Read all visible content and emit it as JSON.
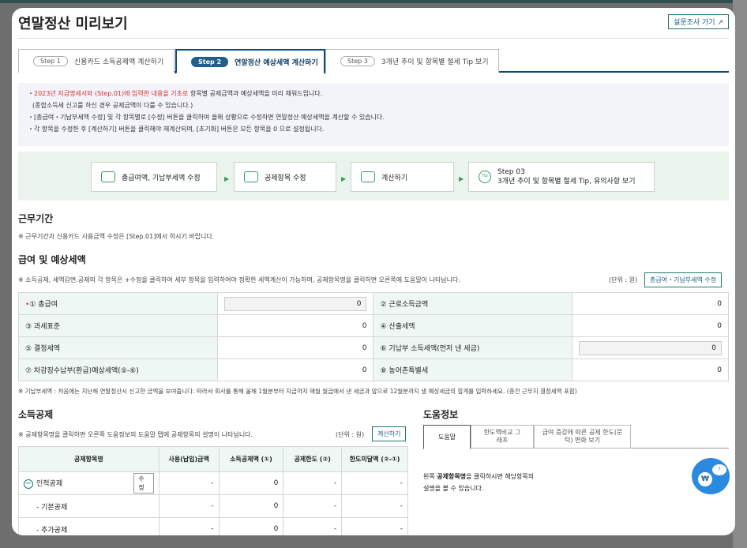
{
  "title": "연말정산 미리보기",
  "survey_button": "설문조사 가기 ↗",
  "tabs": [
    {
      "pill": "Step 1",
      "label": "신용카드 소득공제액 계산하기"
    },
    {
      "pill": "Step 2",
      "label": "연말정산 예상세액 계산하기"
    },
    {
      "pill": "Step 3",
      "label": "3개년 추이 및 항목별 절세 Tip 보기"
    }
  ],
  "notice": {
    "line1_red": "2023년 지급명세서와 (Step.01)에 입력한 내용을 기초로",
    "line1_rest": " 항목별 공제금액과 예상세액을 미리 채워드립니다.",
    "line2": "(종합소득세 신고를 하신 경우 공제금액이 다를 수 있습니다.)",
    "line3": "[총급여・기납부세액 수정] 및 각 항목별로 [수정] 버튼을 클릭하여 올해 상황으로 수정하면 연말정산 예상세액을 계산할 수 있습니다.",
    "line4": "각 항목을 수정한 후 [계산하기] 버튼을 클릭해야 재계산되며, [초기화] 버튼은 모든 항목을 0 으로 설정됩니다."
  },
  "steps": [
    {
      "label": "총급여액, 기납부세액 수정",
      "icon": "salary-edit-icon"
    },
    {
      "label": "공제항목 수정",
      "icon": "document-edit-icon"
    },
    {
      "label": "계산하기",
      "icon": "calculator-icon"
    },
    {
      "label_top": "Step 03",
      "label": "3개년 추이 및 항목별 절세 Tip, 유의사항 보기",
      "icon_text": "Tip"
    }
  ],
  "work_period": {
    "heading": "근무기간",
    "note": "※ 근무기간과 신용카드 사용금액 수정은 [Step.01]에서 하시기 바랍니다."
  },
  "salary": {
    "heading": "급여 및 예상세액",
    "note": "※ 소득공제, 세액감면.공제의 각 항목은 +수정을 클릭하여 세부 항목을 입력하여야 정확한 세액계산이 가능하며, 공제항목명을 클릭하면 오른쪽에 도움말이 나타납니다.",
    "unit": "(단위 : 원)",
    "edit_button": "총급여・기납부세액 수정",
    "rows": [
      [
        {
          "label": "① 총급여",
          "value": "0",
          "boxed": true,
          "required": true
        },
        {
          "label": "② 근로소득금액",
          "value": "0"
        }
      ],
      [
        {
          "label": "③ 과세표준",
          "value": "0"
        },
        {
          "label": "④ 산출세액",
          "value": "0"
        }
      ],
      [
        {
          "label": "⑤ 결정세액",
          "value": "0"
        },
        {
          "label": "⑥ 기납부 소득세액(먼저 낸 세금)",
          "value": "0",
          "boxed": true
        }
      ],
      [
        {
          "label": "⑦ 차감징수납부(환급)예상세액(⑤-⑥)",
          "value": "0"
        },
        {
          "label": "⑧ 농어촌특별세",
          "value": "0"
        }
      ]
    ],
    "footnote": "※ 기납부세액 : 처음에는 지난해 연말정산시 신고한 금액을 보여줍니다. 따라서 회사를 통해 올해 1월분부터 지급까지 매월 월급에서 낸 세금과 앞으로 12월분까지 낼 예상세금의 합계를 입력하세요. (종전 근무지 결정세액 포함)"
  },
  "deduction": {
    "heading": "소득공제",
    "note": "※ 공제항목명을 클릭하면 오른쪽 도움정보의 도움말 탭에 공제항목의 설명이 나타납니다.",
    "unit": "(단위 : 원)",
    "calc_button": "계산하기",
    "headers": [
      "공제항목명",
      "사용(납입)금액",
      "소득공제액 (①)",
      "공제한도 (②)",
      "한도미달액 (②-①)"
    ],
    "rows": [
      {
        "name": "인적공제",
        "edit": "수정",
        "used": "-",
        "deduct": "0",
        "limit": "-",
        "under": "-",
        "toggle": "−"
      },
      {
        "name": "- 기본공제",
        "edit": "",
        "used": "-",
        "deduct": "0",
        "limit": "-",
        "under": "-"
      },
      {
        "name": "- 추가공제",
        "edit": "",
        "used": "-",
        "deduct": "0",
        "limit": "-",
        "under": "-"
      }
    ]
  },
  "help": {
    "heading": "도움정보",
    "tabs": [
      "도움말",
      "한도액비교 그래프",
      "급여 증감에 따른 공제 한도(문턱) 변화 보기"
    ],
    "text_pre": "왼쪽 ",
    "text_bold": "공제항목명",
    "text_post": "을 클릭하시면 해당항목의",
    "text_line2": "설명을 볼 수 있습니다.",
    "icon_coin": "₩",
    "icon_bubble": "?"
  }
}
